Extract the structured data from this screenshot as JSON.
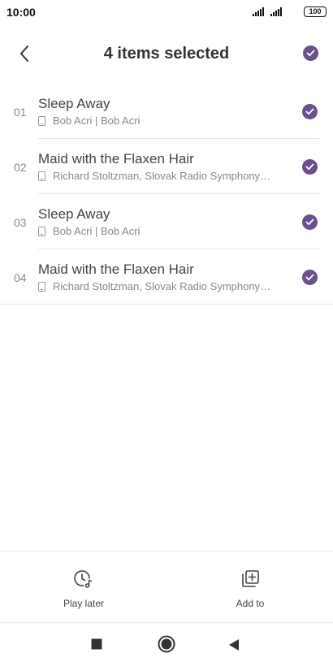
{
  "status_bar": {
    "time": "10:00",
    "battery": "100"
  },
  "header": {
    "title": "4 items selected"
  },
  "songs": [
    {
      "number": "01",
      "title": "Sleep Away",
      "subtitle": "Bob Acri | Bob Acri",
      "selected": true
    },
    {
      "number": "02",
      "title": "Maid with the Flaxen Hair",
      "subtitle": "Richard Stoltzman, Slovak Radio Symphony…",
      "selected": true
    },
    {
      "number": "03",
      "title": "Sleep Away",
      "subtitle": "Bob Acri | Bob Acri",
      "selected": true
    },
    {
      "number": "04",
      "title": "Maid with the Flaxen Hair",
      "subtitle": "Richard Stoltzman, Slovak Radio Symphony…",
      "selected": true
    }
  ],
  "actions": {
    "play_later": "Play later",
    "add_to": "Add to"
  },
  "colors": {
    "accent": "#6b4f8f",
    "text_primary": "#444444",
    "text_secondary": "#888888"
  }
}
